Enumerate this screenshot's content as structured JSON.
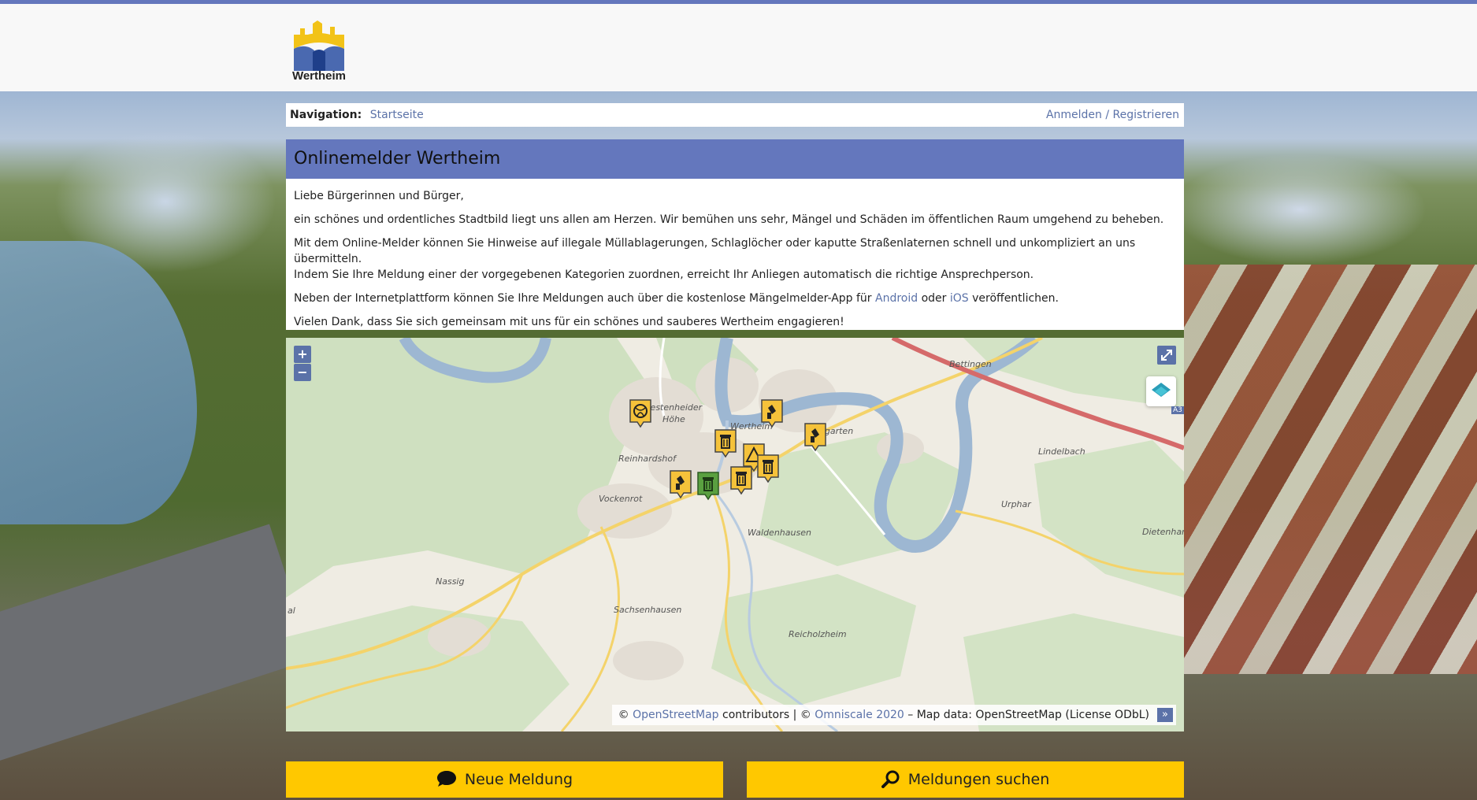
{
  "header": {
    "logo_text": "Wertheim",
    "accent_color": "#6477bd"
  },
  "nav": {
    "label": "Navigation:",
    "home": "Startseite",
    "login": "Anmelden / Registrieren"
  },
  "main": {
    "title": "Onlinemelder Wertheim",
    "greeting": "Liebe Bürgerinnen und Bürger,",
    "p1": "ein schönes und ordentliches Stadtbild liegt uns allen am Herzen. Wir bemühen uns sehr, Mängel und Schäden im öffentlichen Raum umgehend zu beheben.",
    "p2_line1": "Mit dem Online-Melder können Sie Hinweise auf illegale Müllablagerungen, Schlaglöcher oder kaputte Straßenlaternen schnell und unkompliziert an uns übermitteln.",
    "p2_line2": "Indem Sie Ihre Meldung einer der vorgegebenen Kategorien zuordnen, erreicht Ihr Anliegen automatisch die richtige Ansprechperson.",
    "p3_before": "Neben der Internetplattform können Sie Ihre Meldungen auch über die kostenlose Mängelmelder-App für",
    "p3_android": "Android",
    "p3_oder": "oder",
    "p3_ios": "iOS",
    "p3_after": "veröffentlichen.",
    "p4": "Vielen Dank, dass Sie sich gemeinsam mit uns für ein schönes und sauberes Wertheim engagieren!"
  },
  "map": {
    "zoom_in": "+",
    "zoom_out": "−",
    "places": {
      "bettingen": "Bettingen",
      "bestenheider_hohe_1": "Bestenheider",
      "bestenheider_hohe_2": "Höhe",
      "wertheim": "Wertheim",
      "hofgarten": "Hofgarten",
      "reinhardshof": "Reinhardshof",
      "lindelbach": "Lindelbach",
      "vockenrot": "Vockenrot",
      "urphar": "Urphar",
      "waldenhausen": "Waldenhausen",
      "dietenhan": "Dietenhan",
      "nassig": "Nassig",
      "sachsenhausen": "Sachsenhausen",
      "reicholzheim": "Reicholzheim",
      "a3": "A3",
      "al": "al"
    },
    "attribution": {
      "prefix": "©",
      "osm": "OpenStreetMap",
      "contributors": "contributors | ©",
      "omniscale": "Omniscale 2020",
      "suffix": "– Map data: OpenStreetMap (License ODbL)",
      "toggle": "»"
    },
    "marker_color": "#f5c23a",
    "marker_done_color": "#5aa040"
  },
  "actions": {
    "new_report": "Neue Meldung",
    "search_reports": "Meldungen suchen",
    "button_color": "#ffc800"
  }
}
